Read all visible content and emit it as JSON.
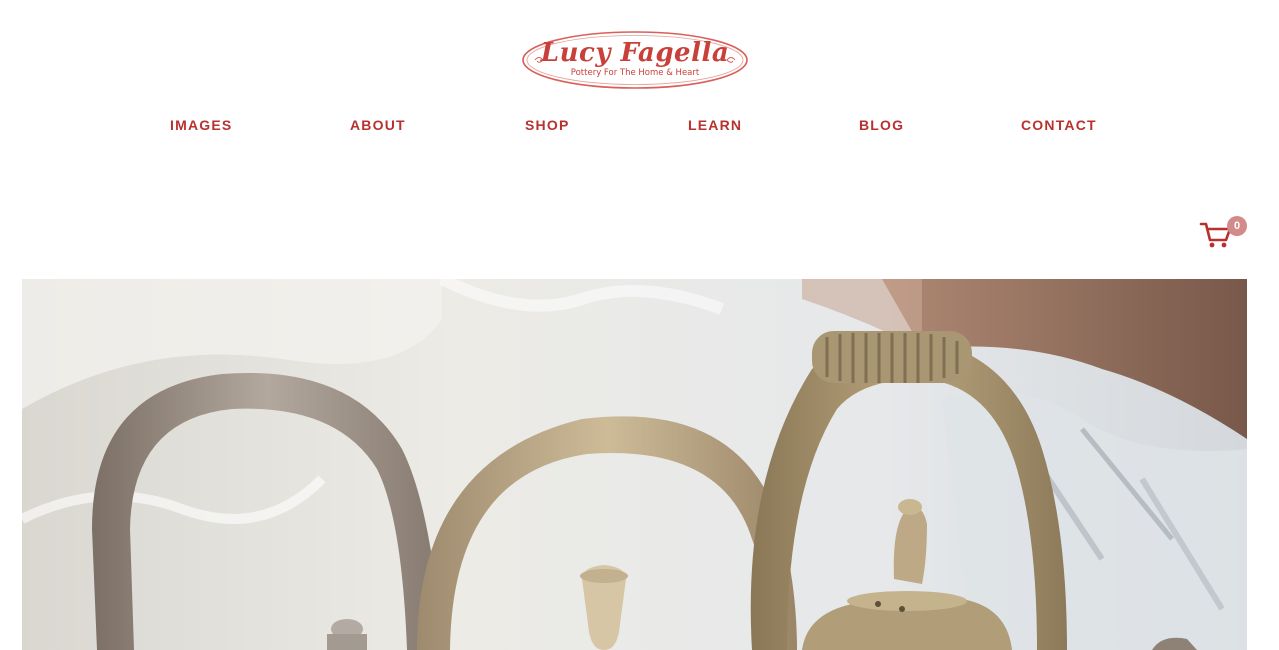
{
  "brand": {
    "name": "Lucy Fagella",
    "tagline": "Pottery For The Home & Heart",
    "color": "#c9403a"
  },
  "nav": {
    "color": "#b8312f",
    "items": [
      {
        "label": "IMAGES"
      },
      {
        "label": "ABOUT"
      },
      {
        "label": "SHOP"
      },
      {
        "label": "LEARN"
      },
      {
        "label": "BLOG"
      },
      {
        "label": "CONTACT"
      }
    ]
  },
  "cart": {
    "icon": "shopping-cart-icon",
    "count": "0",
    "badge_color": "#d38a8a"
  },
  "hero": {
    "image": "photo-of-unglazed-pottery-teapots-with-handles"
  }
}
